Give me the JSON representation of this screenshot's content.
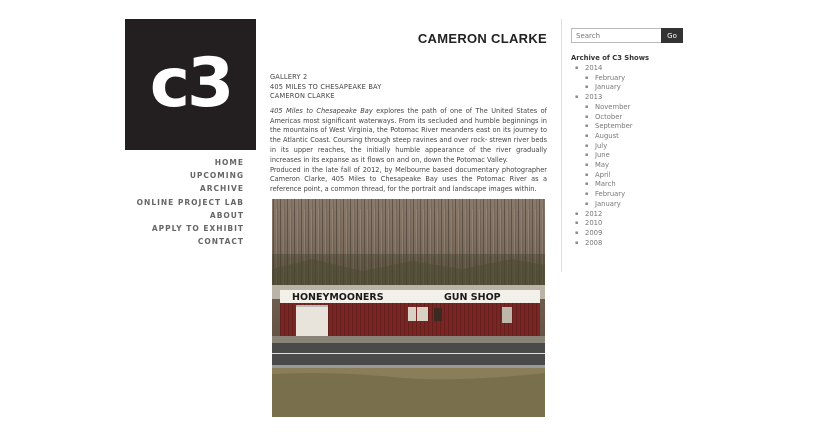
{
  "site": {
    "logo_text": "c3"
  },
  "nav": [
    {
      "label": "HOME"
    },
    {
      "label": "UPCOMING"
    },
    {
      "label": "ARCHIVE"
    },
    {
      "label": "ONLINE PROJECT LAB"
    },
    {
      "label": "ABOUT"
    },
    {
      "label": "APPLY TO EXHIBIT"
    },
    {
      "label": "CONTACT"
    }
  ],
  "page": {
    "title": "CAMERON CLARKE",
    "gallery": "GALLERY 2",
    "exhibition": "405 MILES TO CHESAPEAKE BAY",
    "artist": "CAMERON CLARKE",
    "para1_italic": "405 Miles to Chesapeake Bay",
    "para1_rest": " explores the path of one of The United States of Americas most significant waterways. From its secluded and humble beginnings in the mountains of West Virginia, the Potomac River meanders east on its journey to the Atlantic Coast. Coursing through steep ravines and over rock- strewn river beds in its upper reaches, the initially humble appearance of the river gradually increases in its expanse as it flows on and on, down the Potomac Valley.",
    "para2": "Produced in the late fall of 2012, by Melbourne based documentary photographer Cameron Clarke, 405 Miles to Chesapeake Bay uses the Potomac River as a reference point, a common thread, for the portrait and landscape images within.",
    "photo_sign_left": "HONEYMOONERS",
    "photo_sign_right": "GUN SHOP"
  },
  "search": {
    "placeholder": "Search",
    "button_label": "Go"
  },
  "archive": {
    "heading": "Archive of C3 Shows",
    "years": [
      {
        "year": "2014",
        "months": [
          "February",
          "January"
        ]
      },
      {
        "year": "2013",
        "months": [
          "November",
          "October",
          "September",
          "August",
          "July",
          "June",
          "May",
          "April",
          "March",
          "February",
          "January"
        ]
      },
      {
        "year": "2012",
        "months": []
      },
      {
        "year": "2010",
        "months": []
      },
      {
        "year": "2009",
        "months": []
      },
      {
        "year": "2008",
        "months": []
      }
    ]
  }
}
